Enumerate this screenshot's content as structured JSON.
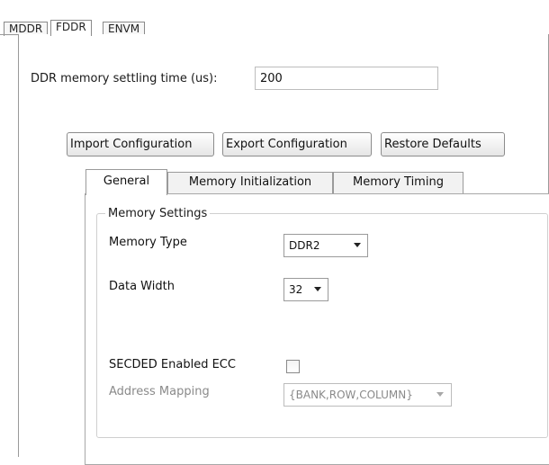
{
  "top_tabs": [
    "MDDR",
    "FDDR",
    "ENVM"
  ],
  "active_top_tab": "FDDR",
  "settling_time": {
    "label": "DDR memory settling time (us):",
    "value": "200"
  },
  "buttons": {
    "import": "Import Configuration",
    "export": "Export Configuration",
    "restore": "Restore Defaults"
  },
  "inner_tabs": [
    "General",
    "Memory Initialization",
    "Memory Timing"
  ],
  "active_inner_tab": "General",
  "memory_settings": {
    "group_title": "Memory Settings",
    "memory_type": {
      "label": "Memory Type",
      "value": "DDR2"
    },
    "data_width": {
      "label": "Data Width",
      "value": "32"
    },
    "secded": {
      "label": "SECDED Enabled ECC",
      "checked": false
    },
    "address_mapping": {
      "label": "Address Mapping",
      "value": "{BANK,ROW,COLUMN}",
      "disabled": true
    }
  }
}
